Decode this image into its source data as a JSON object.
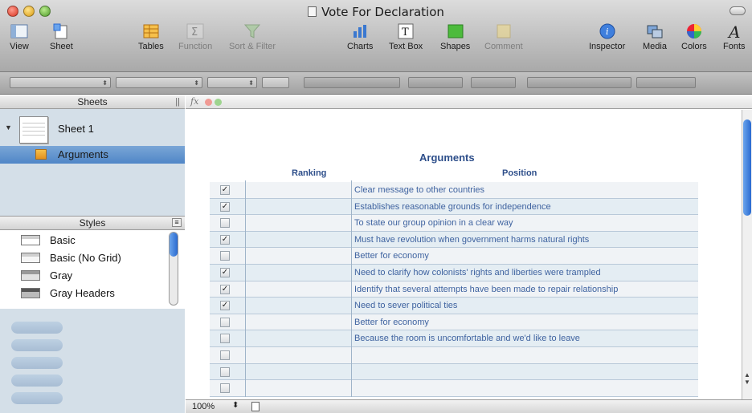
{
  "window": {
    "title": "Vote For Declaration"
  },
  "toolbar": {
    "view": "View",
    "sheet": "Sheet",
    "tables": "Tables",
    "function": "Function",
    "sort_filter": "Sort & Filter",
    "charts": "Charts",
    "text_box": "Text Box",
    "shapes": "Shapes",
    "comment": "Comment",
    "inspector": "Inspector",
    "media": "Media",
    "colors": "Colors",
    "fonts": "Fonts"
  },
  "sidebar": {
    "sheets_header": "Sheets",
    "sheet_name": "Sheet 1",
    "table_name": "Arguments",
    "styles_header": "Styles",
    "styles": [
      "Basic",
      "Basic (No Grid)",
      "Gray",
      "Gray Headers"
    ]
  },
  "table": {
    "title": "Arguments",
    "col_ranking": "Ranking",
    "col_position": "Position",
    "rows": [
      {
        "checked": true,
        "position": "Clear message to other countries"
      },
      {
        "checked": true,
        "position": "Establishes reasonable grounds for independence"
      },
      {
        "checked": false,
        "position": "To state our group opinion in a clear way"
      },
      {
        "checked": true,
        "position": "Must have revolution when government harms natural rights"
      },
      {
        "checked": false,
        "position": "Better for economy"
      },
      {
        "checked": true,
        "position": "Need to clarify how colonists' rights and liberties were trampled"
      },
      {
        "checked": true,
        "position": "Identify that several attempts have been made to repair relationship"
      },
      {
        "checked": true,
        "position": "Need to sever political ties"
      },
      {
        "checked": false,
        "position": "Better for economy"
      },
      {
        "checked": false,
        "position": "Because the room is uncomfortable and we'd like to leave"
      },
      {
        "checked": false,
        "position": ""
      },
      {
        "checked": false,
        "position": ""
      },
      {
        "checked": false,
        "position": ""
      }
    ]
  },
  "status": {
    "zoom": "100%"
  },
  "icons": {
    "check": "✓",
    "disclosure": "▼"
  },
  "colors": {
    "header_text": "#2d4e8a",
    "cell_text": "#3f63a0",
    "selection": "#5b8fcc"
  }
}
